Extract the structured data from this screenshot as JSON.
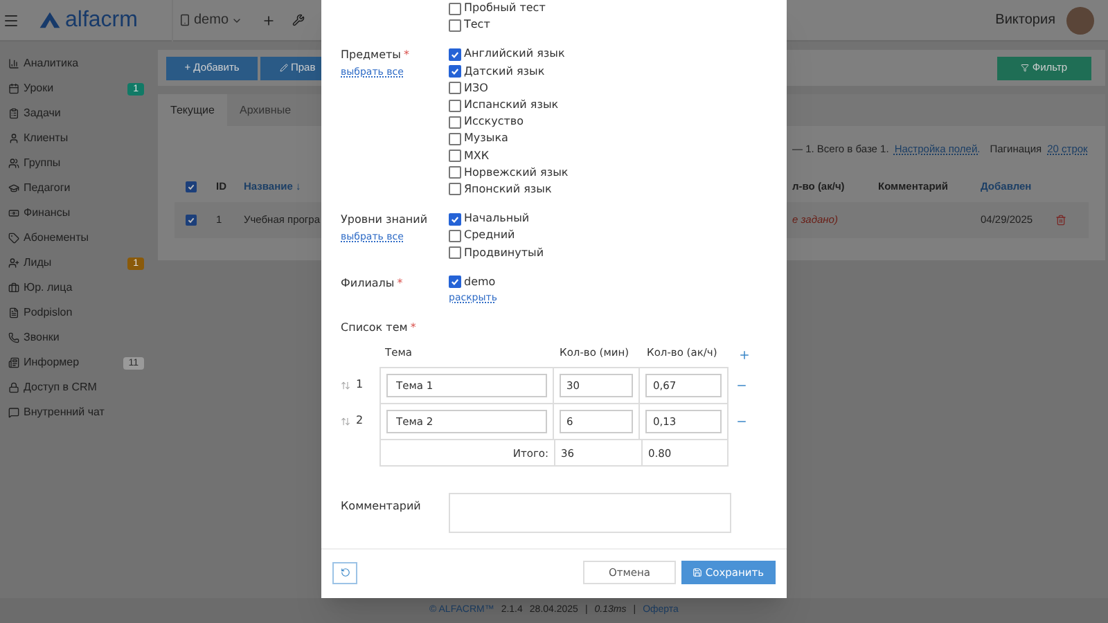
{
  "header": {
    "brand": "alfacrm",
    "branch": "demo",
    "user": "Виктория"
  },
  "sidebar": {
    "items": [
      {
        "label": "Аналитика"
      },
      {
        "label": "Уроки",
        "badge": "1",
        "color": "#117a66"
      },
      {
        "label": "Задачи"
      },
      {
        "label": "Клиенты"
      },
      {
        "label": "Группы"
      },
      {
        "label": "Педагоги"
      },
      {
        "label": "Финансы"
      },
      {
        "label": "Абонементы"
      },
      {
        "label": "Лиды",
        "badge": "1",
        "color": "#8a5a0a"
      },
      {
        "label": "Юр. лица"
      },
      {
        "label": "Podpislon"
      },
      {
        "label": "Звонки"
      },
      {
        "label": "Информер",
        "badge": "11",
        "color": "#9a9a9a"
      },
      {
        "label": "Доступ в CRM"
      },
      {
        "label": "Внутренний чат"
      }
    ]
  },
  "toolbar": {
    "add": "+ Добавить",
    "edit": "Прав",
    "filter": "Фильтр"
  },
  "tabs": [
    {
      "label": "Текущие",
      "selected": true
    },
    {
      "label": "Архивные",
      "selected": false
    }
  ],
  "summary": {
    "text": "— 1. Всего в базе 1.",
    "fields_link": "Настройка полей.",
    "pagination": "Пагинация",
    "rows_link": "20 строк"
  },
  "table": {
    "columns": [
      "ID",
      "Название ↓",
      "л-во (ак/ч)",
      "Комментарий",
      "Добавлен"
    ],
    "all_checked": true,
    "rows": [
      {
        "checked": true,
        "id": "1",
        "name": "Учебная програ",
        "hours": "е задано)",
        "added": "04/29/2025"
      }
    ]
  },
  "modal": {
    "groups": [
      {
        "options": [
          {
            "label": "Пробный тест",
            "checked": false
          },
          {
            "label": "Тест",
            "checked": false
          }
        ]
      },
      {
        "label": "Предметы",
        "required_mark": "*",
        "select_all": "выбрать все",
        "options": [
          {
            "label": "Английский язык",
            "checked": true
          },
          {
            "label": "Датский язык",
            "checked": true
          },
          {
            "label": "ИЗО",
            "checked": false
          },
          {
            "label": "Испанский язык",
            "checked": false
          },
          {
            "label": "Исскуство",
            "checked": false
          },
          {
            "label": "Музыка",
            "checked": false
          },
          {
            "label": "МХК",
            "checked": false
          },
          {
            "label": "Норвежский язык",
            "checked": false
          },
          {
            "label": "Японский язык",
            "checked": false
          }
        ]
      },
      {
        "label": "Уровни знаний",
        "select_all": "выбрать все",
        "options": [
          {
            "label": "Начальный",
            "checked": true
          },
          {
            "label": "Средний",
            "checked": false
          },
          {
            "label": "Продвинутый",
            "checked": false
          }
        ]
      },
      {
        "label": "Филиалы",
        "required_mark": "*",
        "expand": "раскрыть",
        "options": [
          {
            "label": "demo",
            "checked": true
          }
        ]
      }
    ],
    "topics": {
      "label": "Список тем",
      "required_mark": "*",
      "columns": [
        "Тема",
        "Кол-во (мин)",
        "Кол-во (ак/ч)"
      ],
      "rows": [
        {
          "num": "1",
          "name": "Тема 1",
          "minutes": "30",
          "hours": "0,67"
        },
        {
          "num": "2",
          "name": "Тема 2",
          "minutes": "6",
          "hours": "0,13"
        }
      ],
      "total_label": "Итого:",
      "total_minutes": "36",
      "total_hours": "0.80"
    },
    "comment_label": "Комментарий",
    "cancel": "Отмена",
    "save": "Сохранить"
  },
  "footer": {
    "copyright": "© ALFACRM™",
    "version": "2.1.4",
    "date": "28.04.2025",
    "separators": [
      "|",
      "|"
    ],
    "timing": "0.13ms",
    "offer": "Оферта"
  }
}
